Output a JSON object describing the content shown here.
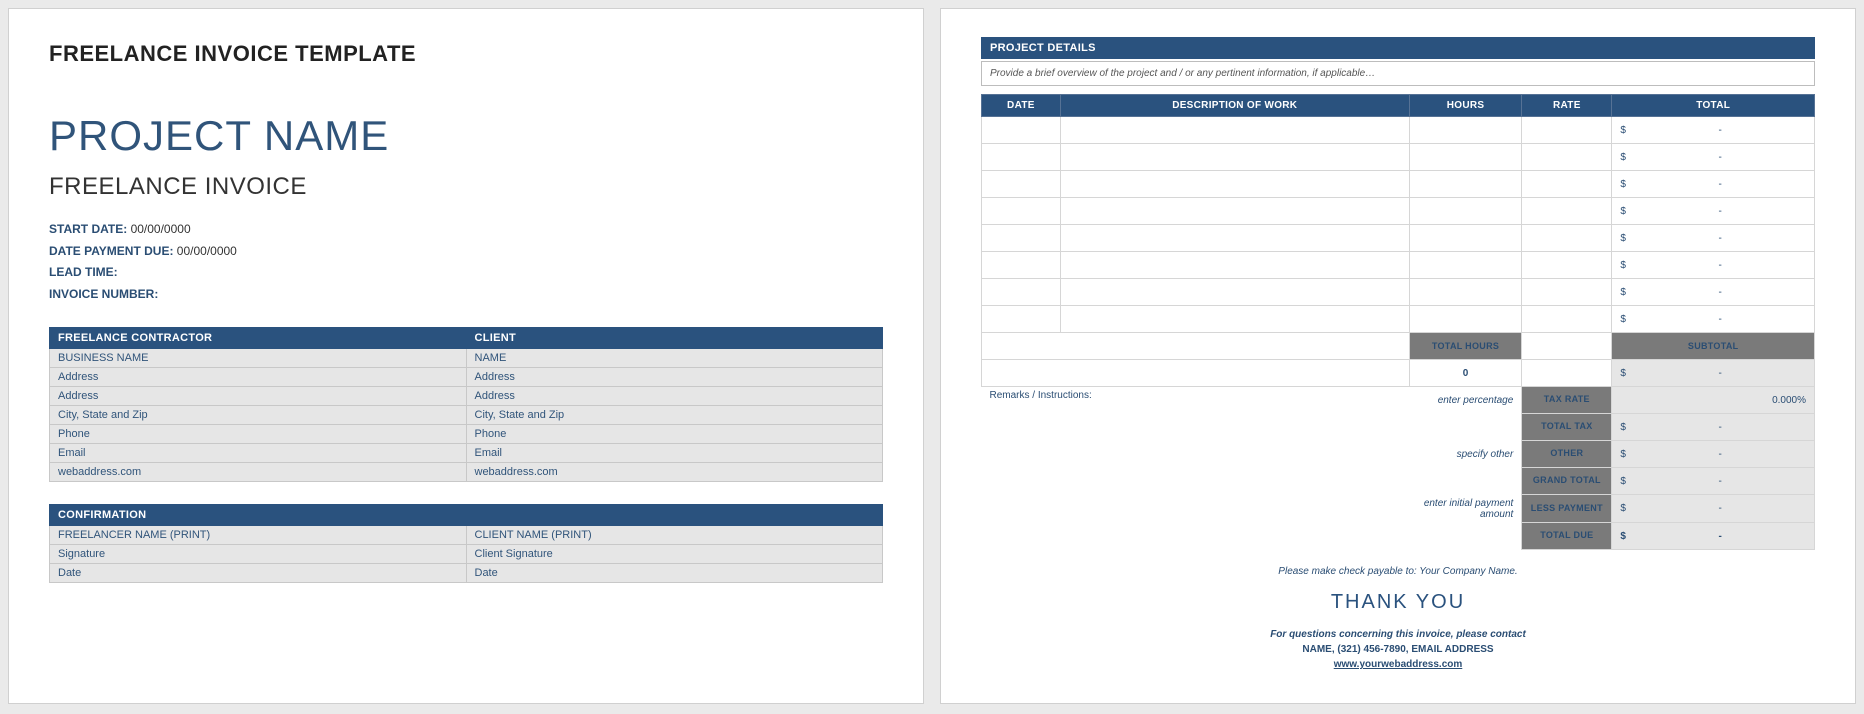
{
  "page1": {
    "templateTitle": "FREELANCE INVOICE TEMPLATE",
    "projectName": "PROJECT NAME",
    "subtitle": "FREELANCE INVOICE",
    "meta": {
      "startLabel": "START DATE:",
      "startVal": "00/00/0000",
      "dueLabel": "DATE PAYMENT DUE:",
      "dueVal": "00/00/0000",
      "leadLabel": "LEAD TIME:",
      "leadVal": "",
      "invLabel": "INVOICE NUMBER:",
      "invVal": ""
    },
    "contractorHdr": "FREELANCE CONTRACTOR",
    "clientHdr": "CLIENT",
    "rows": [
      [
        "BUSINESS NAME",
        "NAME"
      ],
      [
        "Address",
        "Address"
      ],
      [
        "Address",
        "Address"
      ],
      [
        "City, State and Zip",
        "City, State and Zip"
      ],
      [
        "Phone",
        "Phone"
      ],
      [
        "Email",
        "Email"
      ],
      [
        "webaddress.com",
        "webaddress.com"
      ]
    ],
    "confHdr": "CONFIRMATION",
    "confRows": [
      [
        "FREELANCER NAME (PRINT)",
        "CLIENT NAME (PRINT)"
      ],
      [
        "Signature",
        "Client Signature"
      ],
      [
        "Date",
        "Date"
      ]
    ]
  },
  "page2": {
    "sectionTitle": "PROJECT DETAILS",
    "overview": "Provide a brief overview of the project and / or any pertinent information, if applicable…",
    "cols": {
      "date": "DATE",
      "desc": "DESCRIPTION OF WORK",
      "hours": "HOURS",
      "rate": "RATE",
      "total": "TOTAL"
    },
    "blankRows": 8,
    "moneyDash": "-",
    "moneySym": "$",
    "totalsBar": {
      "totalHours": "TOTAL HOURS",
      "subtotal": "SUBTOTAL",
      "hoursVal": "0"
    },
    "remarks": "Remarks / Instructions:",
    "taxNote": "enter percentage",
    "otherNote": "specify other",
    "lessNote": "enter initial payment amount",
    "labels": {
      "taxRate": "TAX RATE",
      "totalTax": "TOTAL TAX",
      "other": "OTHER",
      "grand": "GRAND TOTAL",
      "less": "LESS PAYMENT",
      "due": "TOTAL DUE"
    },
    "taxRateVal": "0.000%",
    "footer": {
      "payable": "Please make check payable to: Your Company Name.",
      "thanks": "THANK YOU",
      "q1": "For questions concerning this invoice, please contact",
      "q2": "NAME, (321) 456-7890, EMAIL ADDRESS",
      "link": "www.yourwebaddress.com"
    }
  }
}
